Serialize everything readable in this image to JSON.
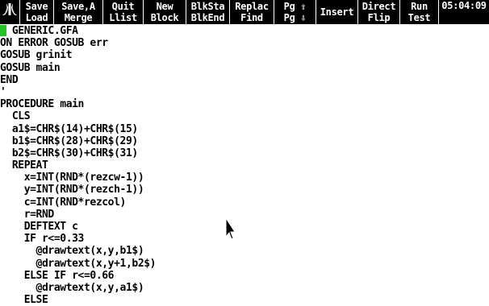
{
  "menu": [
    {
      "top": "Save",
      "bottom": "Load"
    },
    {
      "top": "Save,A",
      "bottom": "Merge"
    },
    {
      "top": "Quit",
      "bottom": "Llist"
    },
    {
      "top": "New",
      "bottom": "Block"
    },
    {
      "top": "BlkSta",
      "bottom": "BlkEnd"
    },
    {
      "top": "Replac",
      "bottom": "Find"
    },
    {
      "top": "Pg ⇧",
      "bottom": "Pg ⇩"
    },
    {
      "top": "",
      "bottom": "Insert"
    },
    {
      "top": "Direct",
      "bottom": "Flip"
    },
    {
      "top": "Run",
      "bottom": "Test"
    }
  ],
  "clock": "05:04:09",
  "icons": {
    "logo": "atari-fuji-icon",
    "pointer": "mouse-pointer-icon"
  },
  "colors": {
    "menubar": "#000000",
    "cursor": "#22c322"
  },
  "code_lines": [
    "  GENERIC.GFA",
    "ON ERROR GOSUB err",
    "GOSUB grinit",
    "GOSUB main",
    "END",
    "'",
    "PROCEDURE main",
    "  CLS",
    "  a1$=CHR$(14)+CHR$(15)",
    "  b1$=CHR$(28)+CHR$(29)",
    "  b2$=CHR$(30)+CHR$(31)",
    "  REPEAT",
    "    x=INT(RND*(rezcw-1))",
    "    y=INT(RND*(rezch-1))",
    "    c=INT(RND*rezcol)",
    "    r=RND",
    "    DEFTEXT c",
    "    IF r<=0.33",
    "      @drawtext(x,y,b1$)",
    "      @drawtext(x,y+1,b2$)",
    "    ELSE IF r<=0.66",
    "      @drawtext(x,y,a1$)",
    "    ELSE"
  ]
}
